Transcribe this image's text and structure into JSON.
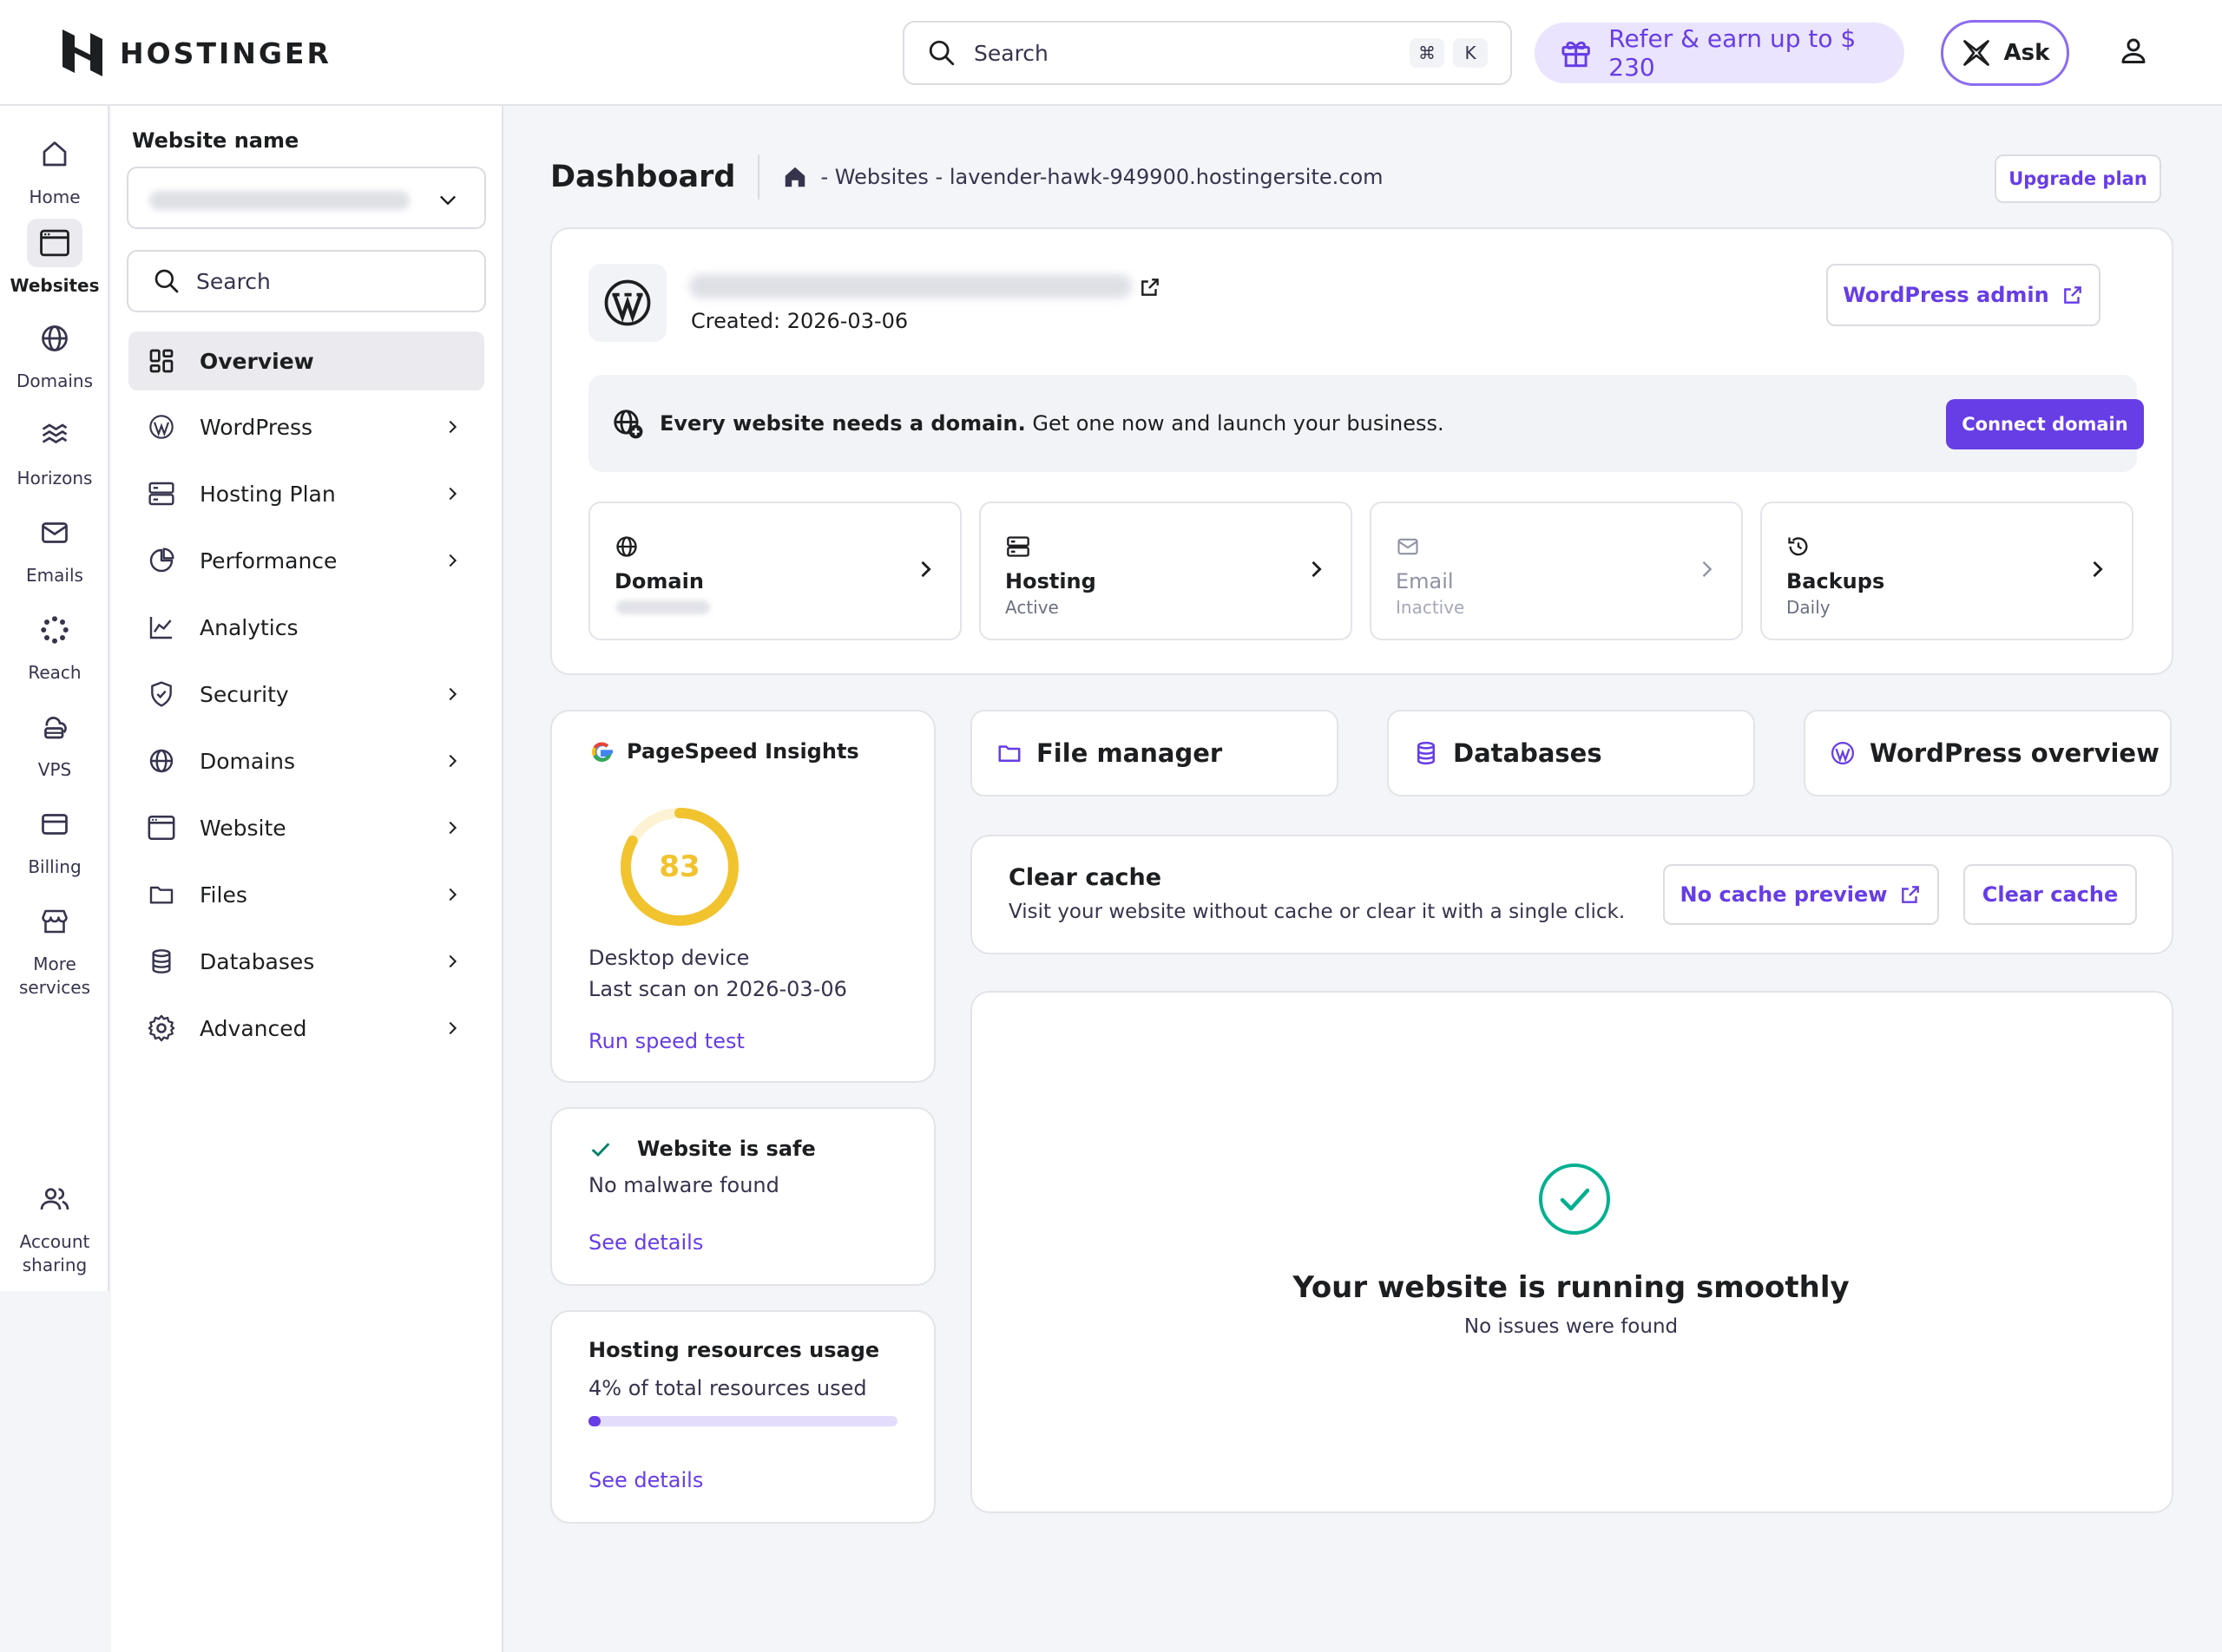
{
  "topbar": {
    "brand": "HOSTINGER",
    "search_placeholder": "Search",
    "shortcut_keys": [
      "⌘",
      "K"
    ],
    "refer_label": "Refer & earn up to $ 230",
    "ask_label": "Ask"
  },
  "rail": {
    "items": [
      {
        "label": "Home",
        "icon": "home-icon"
      },
      {
        "label": "Websites",
        "icon": "browser-window-icon",
        "active": true
      },
      {
        "label": "Domains",
        "icon": "globe-icon"
      },
      {
        "label": "Horizons",
        "icon": "horizons-icon"
      },
      {
        "label": "Emails",
        "icon": "mail-icon"
      },
      {
        "label": "Reach",
        "icon": "reach-icon"
      },
      {
        "label": "VPS",
        "icon": "cloud-server-icon"
      },
      {
        "label": "Billing",
        "icon": "card-icon"
      },
      {
        "label": "More services",
        "icon": "store-icon"
      },
      {
        "label": "Account sharing",
        "icon": "users-icon"
      }
    ]
  },
  "sidebar": {
    "title": "Website name",
    "search_placeholder": "Search",
    "items": [
      {
        "label": "Overview",
        "icon": "grid-icon",
        "active": true,
        "chevron": false
      },
      {
        "label": "WordPress",
        "icon": "wordpress-icon",
        "chevron": true
      },
      {
        "label": "Hosting Plan",
        "icon": "server-icon",
        "chevron": true
      },
      {
        "label": "Performance",
        "icon": "pie-icon",
        "chevron": true
      },
      {
        "label": "Analytics",
        "icon": "chart-icon",
        "chevron": false
      },
      {
        "label": "Security",
        "icon": "shield-icon",
        "chevron": true
      },
      {
        "label": "Domains",
        "icon": "globe-icon",
        "chevron": true
      },
      {
        "label": "Website",
        "icon": "browser-window-icon",
        "chevron": true
      },
      {
        "label": "Files",
        "icon": "folder-icon",
        "chevron": true
      },
      {
        "label": "Databases",
        "icon": "database-icon",
        "chevron": true
      },
      {
        "label": "Advanced",
        "icon": "gear-icon",
        "chevron": true
      }
    ]
  },
  "header": {
    "title": "Dashboard",
    "breadcrumb": "- Websites - lavender-hawk-949900.hostingersite.com",
    "upgrade_label": "Upgrade plan"
  },
  "site_card": {
    "created": "Created: 2026-03-06",
    "wp_admin_label": "WordPress admin",
    "banner_bold": "Every website needs a domain.",
    "banner_text": " Get one now and launch your business.",
    "connect_label": "Connect domain",
    "tiles": [
      {
        "label": "Domain",
        "status": "",
        "icon": "globe-icon",
        "enabled": true
      },
      {
        "label": "Hosting",
        "status": "Active",
        "icon": "server-icon",
        "enabled": true
      },
      {
        "label": "Email",
        "status": "Inactive",
        "icon": "mail-icon",
        "enabled": false
      },
      {
        "label": "Backups",
        "status": "Daily",
        "icon": "history-icon",
        "enabled": true
      }
    ]
  },
  "pagespeed": {
    "title": "PageSpeed Insights",
    "score": 83,
    "device": "Desktop device",
    "last_scan": "Last scan on 2026-03-06",
    "run_label": "Run speed test",
    "ring_color": "#f1c32e"
  },
  "security": {
    "title": "Website is safe",
    "subtitle": "No malware found",
    "link": "See details"
  },
  "resources": {
    "title": "Hosting resources usage",
    "subtitle": "4% of total resources used",
    "usage_percent": 4,
    "link": "See details"
  },
  "quick_actions": [
    {
      "label": "File manager",
      "icon": "folder-icon"
    },
    {
      "label": "Databases",
      "icon": "database-icon"
    },
    {
      "label": "WordPress overview",
      "icon": "wordpress-icon"
    }
  ],
  "cache": {
    "title": "Clear cache",
    "subtitle": "Visit your website without cache or clear it with a single click.",
    "preview_label": "No cache preview",
    "clear_label": "Clear cache"
  },
  "status": {
    "title": "Your website is running smoothly",
    "subtitle": "No issues were found",
    "accent": "#00b090"
  },
  "colors": {
    "primary": "#673de6",
    "primary_light": "#ebe4ff"
  }
}
